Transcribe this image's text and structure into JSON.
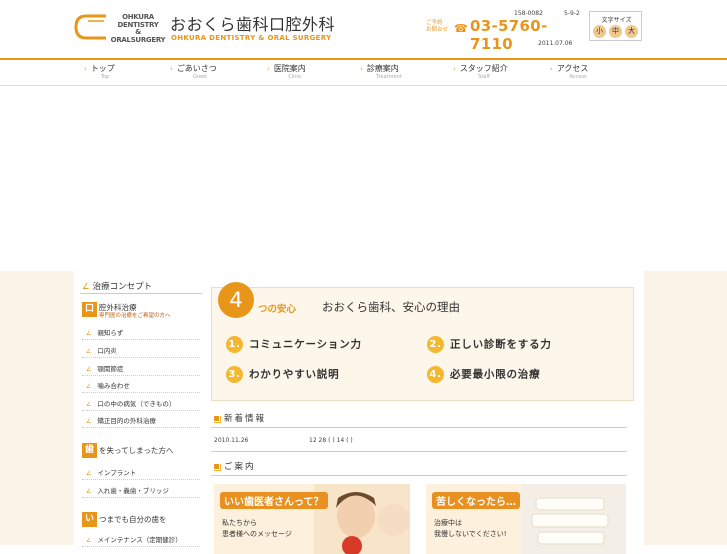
{
  "header": {
    "logo_en": [
      "OHKURA",
      "DENTISTRY",
      "&",
      "ORALSURGERY"
    ],
    "logo_jp": "おおくら歯科口腔外科",
    "logo_sub": "OHKURA DENTISTRY & ORAL SURGERY",
    "postal": "158-0082",
    "addr_num": "5-9-2",
    "tel_label_1": "ご予約",
    "tel_label_2": "お問合せ",
    "tel": "03-5760-7110",
    "update_date": "2011.07.06",
    "fontsize_label": "文字サイズ",
    "fontsize_small": "小",
    "fontsize_mid": "中",
    "fontsize_large": "大"
  },
  "nav": [
    {
      "label": "トップ",
      "sub": "Top"
    },
    {
      "label": "ごあいさつ",
      "sub": "Greet"
    },
    {
      "label": "医院案内",
      "sub": "Clinic"
    },
    {
      "label": "診療案内",
      "sub": "Treatment"
    },
    {
      "label": "スタッフ紹介",
      "sub": "Staff"
    },
    {
      "label": "アクセス",
      "sub": "Access"
    }
  ],
  "sidebar": {
    "title": "治療コンセプト",
    "cat1": {
      "icon": "口",
      "title": "腔外科治療",
      "sub": "専門医の治療をご希望の方へ"
    },
    "cat1_links": [
      "親知らず",
      "口内炎",
      "顎関節症",
      "噛み合わせ",
      "口の中の病気（できもの）",
      "矯正目的の外科治療"
    ],
    "cat2": {
      "icon": "歯",
      "title": "を失ってしまった方へ"
    },
    "cat2_links": [
      "インプラント",
      "入れ歯・義歯・ブリッジ"
    ],
    "cat3": {
      "icon": "い",
      "title": "つまでも自分の歯を"
    },
    "cat3_links": [
      "メインテナンス（定期健診）"
    ]
  },
  "feature": {
    "number": "4",
    "head_jp": "つの安心",
    "head": "おおくら歯科、安心の理由",
    "items": [
      {
        "num": "1.",
        "text": "コミュニケーション力"
      },
      {
        "num": "2.",
        "text": "正しい診断をする力"
      },
      {
        "num": "3.",
        "text": "わかりやすい説明"
      },
      {
        "num": "4.",
        "text": "必要最小限の治療"
      }
    ]
  },
  "news": {
    "heading": "新着情報",
    "items": [
      {
        "date": "2010.11.26",
        "text": "12 28 ( )  14 ( )"
      }
    ]
  },
  "guide": {
    "heading": "ご案内",
    "banner1": {
      "title": "いい歯医者さんって？",
      "line1": "私たちから",
      "line2": "患者様へのメッセージ"
    },
    "banner2": {
      "title": "苦しくなったら…",
      "line1": "治療中は",
      "line2": "我慢しないでください!"
    }
  },
  "colors": {
    "accent": "#e8961a",
    "cream": "#faf3e8",
    "yellow": "#f4b830"
  }
}
